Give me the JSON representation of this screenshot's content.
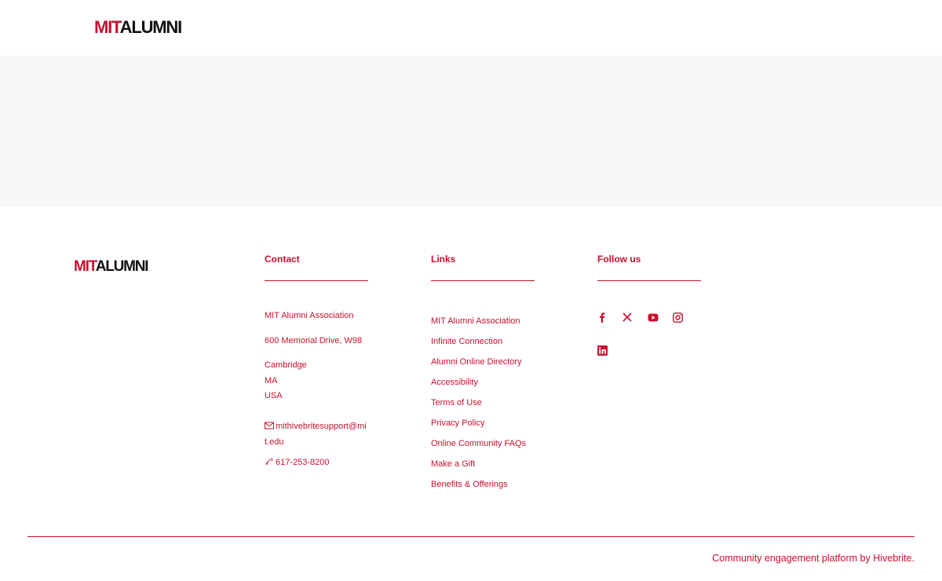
{
  "header": {
    "logo": {
      "mit": "MIT",
      "alumni": "ALUMNI"
    }
  },
  "footer": {
    "logo": {
      "mit": "MIT",
      "alumni": "ALUMNI"
    },
    "contact": {
      "title": "Contact",
      "org": "MIT Alumni Association",
      "address": "600 Memorial Drive, W98",
      "city": "Cambridge",
      "state": "MA",
      "country": "USA",
      "email": "mithivebritesupport@mit.edu",
      "phone": "617-253-8200"
    },
    "links": {
      "title": "Links",
      "items": [
        "MIT Alumni Association",
        "Infinite Connection",
        "Alumni Online Directory",
        "Accessibility",
        "Terms of Use",
        "Privacy Policy",
        "Online Community FAQs",
        "Make a Gift",
        "Benefits & Offerings"
      ]
    },
    "follow": {
      "title": "Follow us",
      "icons": [
        "facebook-icon",
        "x-icon",
        "youtube-icon",
        "instagram-icon",
        "linkedin-icon"
      ]
    },
    "powered_by": "Community engagement platform by Hivebrite."
  },
  "colors": {
    "accent": "#c8102e",
    "band": "#f6f7f9",
    "text_dark": "#111111"
  }
}
